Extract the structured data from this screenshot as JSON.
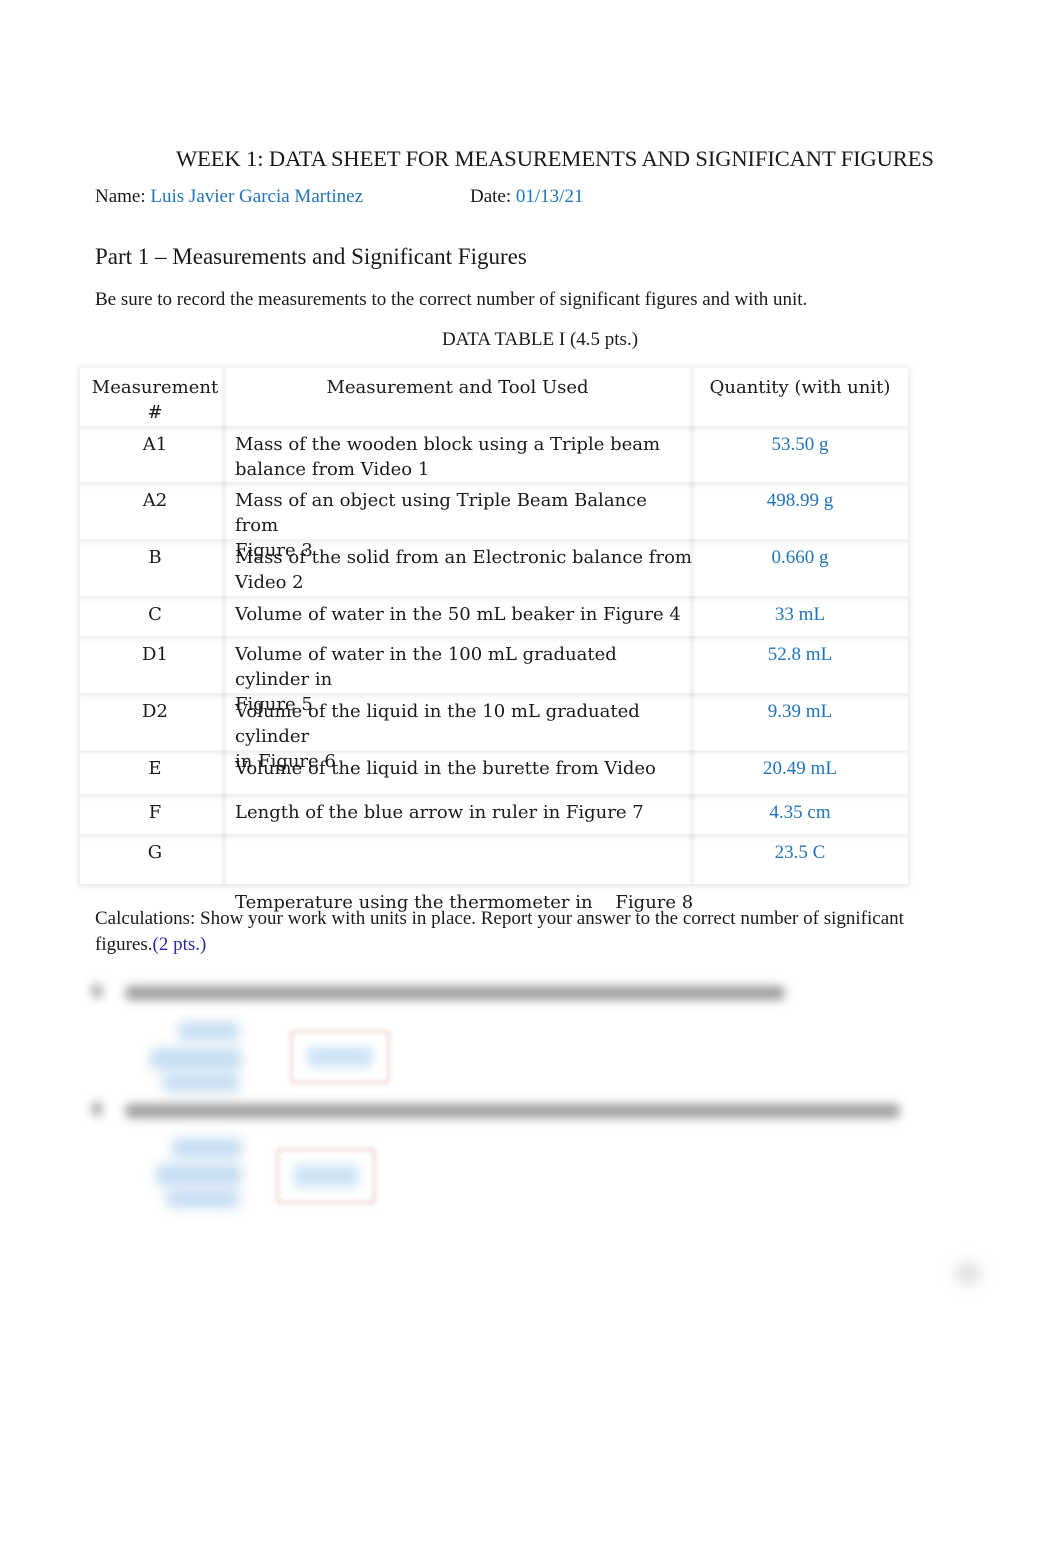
{
  "document": {
    "title": "WEEK 1: DATA SHEET FOR MEASUREMENTS AND SIGNIFICANT FIGURES",
    "name_label": "Name:",
    "name_value": "Luis Javier Garcia Martinez",
    "date_label": "Date:",
    "date_value": "01/13/21"
  },
  "part1": {
    "heading": "Part 1 – Measurements and Significant Figures",
    "instruction": "Be sure to record the measurements to the correct number of significant figures and with unit.",
    "table_caption": "DATA TABLE I (4.5 pts.)",
    "table": {
      "headers": {
        "id_line1": "Measurement",
        "id_line2": "#",
        "description": "Measurement and Tool Used",
        "quantity": "Quantity (with unit)"
      },
      "rows": [
        {
          "id": "A1",
          "desc1": "Mass of the wooden block using a Triple beam",
          "desc2": "balance from  Video 1",
          "qty": "53.50 g"
        },
        {
          "id": "A2",
          "desc1": "Mass of an object using Triple Beam Balance from",
          "desc2": "Figure 3",
          "qty": "498.99 g"
        },
        {
          "id": "B",
          "desc1": "Mass of the solid from an Electronic balance from",
          "desc2": "Video 2",
          "qty": "0.660 g"
        },
        {
          "id": "C",
          "desc1": "Volume of water in the 50 mL beaker in Figure 4",
          "desc2": "",
          "qty": "33 mL"
        },
        {
          "id": "D1",
          "desc1": "Volume of water in the 100 mL graduated cylinder in",
          "desc2": "Figure 5",
          "qty": "52.8 mL"
        },
        {
          "id": "D2",
          "desc1": "Volume of the liquid in the 10 mL graduated cylinder",
          "desc2": "in Figure 6",
          "qty": "9.39 mL"
        },
        {
          "id": "E",
          "desc1": "Volume of the liquid in the burette from Video",
          "desc2": "",
          "qty": "20.49 mL"
        },
        {
          "id": "F",
          "desc1": "Length of the blue arrow in ruler in Figure 7",
          "desc2": "",
          "qty": "4.35 cm"
        },
        {
          "id": "G",
          "desc1": "Temperature using the thermometer in    Figure 8",
          "desc2": "",
          "qty": "23.5 C"
        }
      ]
    }
  },
  "calculations": {
    "text": "Calculations: Show your work with units in place. Report your answer to the correct number of significant figures.",
    "points": "(2 pts.)"
  },
  "colors": {
    "answer_blue": "#1f74bb",
    "points_navy": "#2a2aa8"
  }
}
